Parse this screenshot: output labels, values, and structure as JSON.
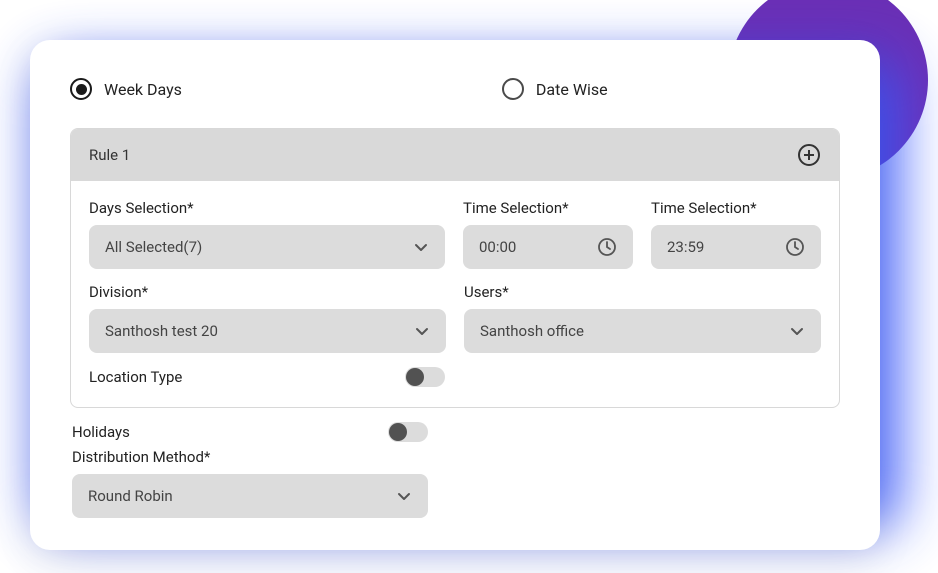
{
  "radios": {
    "weekDays": {
      "label": "Week Days",
      "selected": true
    },
    "dateWise": {
      "label": "Date Wise",
      "selected": false
    }
  },
  "rule": {
    "title": "Rule 1",
    "daysSelection": {
      "label": "Days Selection*",
      "value": "All Selected(7)"
    },
    "timeStart": {
      "label": "Time Selection*",
      "value": "00:00"
    },
    "timeEnd": {
      "label": "Time Selection*",
      "value": "23:59"
    },
    "division": {
      "label": "Division*",
      "value": "Santhosh test 20"
    },
    "users": {
      "label": "Users*",
      "value": "Santhosh office"
    },
    "locationType": {
      "label": "Location Type",
      "enabled": false
    }
  },
  "holidays": {
    "label": "Holidays",
    "enabled": false
  },
  "distributionMethod": {
    "label": "Distribution Method*",
    "value": "Round Robin"
  }
}
